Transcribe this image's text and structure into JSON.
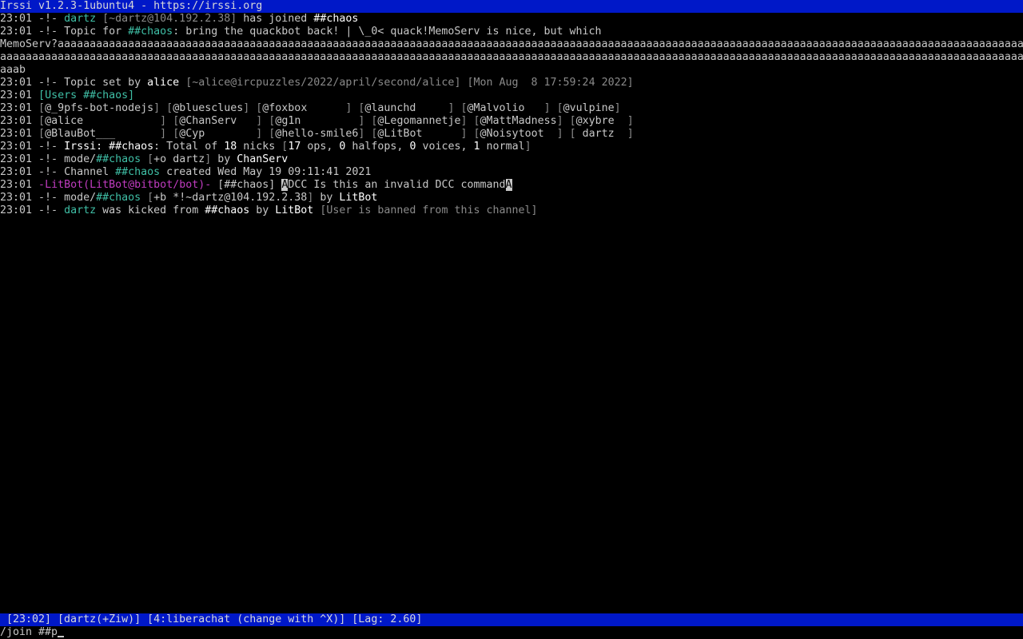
{
  "title_bar": "Irssi v1.2.3-1ubuntu4 - https://irssi.org",
  "colors": {
    "default": "#c8c8c8",
    "bright": "#ffffff",
    "cyan": "#3fbfa6",
    "grey": "#8a8a8a",
    "magenta": "#c03cc0",
    "bar_bg": "#0018c8",
    "bar_fg": "#d8d8d8"
  },
  "lines": [
    [
      [
        "23:01 ",
        "default"
      ],
      [
        "-!- ",
        "default"
      ],
      [
        "dartz",
        "cyan"
      ],
      [
        " [",
        "grey"
      ],
      [
        "~dartz@104.192.2.38",
        "grey"
      ],
      [
        "]",
        "grey"
      ],
      [
        " has joined ",
        "default"
      ],
      [
        "##chaos",
        "bright"
      ]
    ],
    [
      [
        "23:01 ",
        "default"
      ],
      [
        "-!- ",
        "default"
      ],
      [
        "Topic for ",
        "default"
      ],
      [
        "##chaos",
        "cyan"
      ],
      [
        ": bring the quackbot back! | \\_0< quack!MemoServ is nice, but which",
        "default"
      ]
    ],
    [
      [
        "MemoServ?aaaaaaaaaaaaaaaaaaaaaaaaaaaaaaaaaaaaaaaaaaaaaaaaaaaaaaaaaaaaaaaaaaaaaaaaaaaaaaaaaaaaaaaaaaaaaaaaaaaaaaaaaaaaaaaaaaaaaaaaaaaaaaaaaaaaaaaaaaaaaaaaaaaaaaaaaaaaaaaaaaaaaaaaaaaaaaaaaaaaaaa",
        "default"
      ]
    ],
    [
      [
        "aaaaaaaaaaaaaaaaaaaaaaaaaaaaaaaaaaaaaaaaaaaaaaaaaaaaaaaaaaaaaaaaaaaaaaaaaaaaaaaaaaaaaaaaaaaaaaaaaaaaaaaaaaaaaaaaaaaaaaaaaaaaaaaaaaaaaaaaaaaaaaaaaaaaaaaaaaaaaaaaaaaaaaaaaaaaaaaaaaaaaaaaaaaaaaaa",
        "default"
      ]
    ],
    [
      [
        "aaab",
        "default"
      ]
    ],
    [
      [
        "23:01 ",
        "default"
      ],
      [
        "-!- ",
        "default"
      ],
      [
        "Topic set by ",
        "default"
      ],
      [
        "alice",
        "bright"
      ],
      [
        " [",
        "grey"
      ],
      [
        "~alice@ircpuzzles/2022/april/second/alice",
        "grey"
      ],
      [
        "]",
        "grey"
      ],
      [
        " [",
        "grey"
      ],
      [
        "Mon Aug  8 17:59:24 2022",
        "grey"
      ],
      [
        "]",
        "grey"
      ]
    ],
    [
      [
        "23:01 ",
        "default"
      ],
      [
        "[",
        "cyan"
      ],
      [
        "Users ",
        "cyan"
      ],
      [
        "##chaos",
        "cyan"
      ],
      [
        "]",
        "cyan"
      ]
    ],
    [
      [
        "23:01 ",
        "default"
      ],
      [
        "[",
        "grey"
      ],
      [
        "@_9pfs-bot-nodejs",
        "default"
      ],
      [
        "] ",
        "grey"
      ],
      [
        "[",
        "grey"
      ],
      [
        "@bluesclues",
        "default"
      ],
      [
        "] ",
        "grey"
      ],
      [
        "[",
        "grey"
      ],
      [
        "@foxbox      ",
        "default"
      ],
      [
        "] ",
        "grey"
      ],
      [
        "[",
        "grey"
      ],
      [
        "@launchd     ",
        "default"
      ],
      [
        "] ",
        "grey"
      ],
      [
        "[",
        "grey"
      ],
      [
        "@Malvolio   ",
        "default"
      ],
      [
        "] ",
        "grey"
      ],
      [
        "[",
        "grey"
      ],
      [
        "@vulpine",
        "default"
      ],
      [
        "]",
        "grey"
      ]
    ],
    [
      [
        "23:01 ",
        "default"
      ],
      [
        "[",
        "grey"
      ],
      [
        "@alice            ",
        "default"
      ],
      [
        "] ",
        "grey"
      ],
      [
        "[",
        "grey"
      ],
      [
        "@ChanServ   ",
        "default"
      ],
      [
        "] ",
        "grey"
      ],
      [
        "[",
        "grey"
      ],
      [
        "@g1n         ",
        "default"
      ],
      [
        "] ",
        "grey"
      ],
      [
        "[",
        "grey"
      ],
      [
        "@Legomannetje",
        "default"
      ],
      [
        "] ",
        "grey"
      ],
      [
        "[",
        "grey"
      ],
      [
        "@MattMadness",
        "default"
      ],
      [
        "] ",
        "grey"
      ],
      [
        "[",
        "grey"
      ],
      [
        "@xybre  ",
        "default"
      ],
      [
        "]",
        "grey"
      ]
    ],
    [
      [
        "23:01 ",
        "default"
      ],
      [
        "[",
        "grey"
      ],
      [
        "@BlauBot___       ",
        "default"
      ],
      [
        "] ",
        "grey"
      ],
      [
        "[",
        "grey"
      ],
      [
        "@Cyp        ",
        "default"
      ],
      [
        "] ",
        "grey"
      ],
      [
        "[",
        "grey"
      ],
      [
        "@hello-smile6",
        "default"
      ],
      [
        "] ",
        "grey"
      ],
      [
        "[",
        "grey"
      ],
      [
        "@LitBot      ",
        "default"
      ],
      [
        "] ",
        "grey"
      ],
      [
        "[",
        "grey"
      ],
      [
        "@Noisytoot  ",
        "default"
      ],
      [
        "] ",
        "grey"
      ],
      [
        "[",
        "grey"
      ],
      [
        " dartz  ",
        "default"
      ],
      [
        "]",
        "grey"
      ]
    ],
    [
      [
        "23:01 ",
        "default"
      ],
      [
        "-!- ",
        "default"
      ],
      [
        "Irssi: ",
        "bright"
      ],
      [
        "##chaos",
        "bright"
      ],
      [
        ": Total of ",
        "default"
      ],
      [
        "18",
        "bright"
      ],
      [
        " nicks ",
        "default"
      ],
      [
        "[",
        "grey"
      ],
      [
        "17",
        "bright"
      ],
      [
        " ops, ",
        "default"
      ],
      [
        "0",
        "bright"
      ],
      [
        " halfops, ",
        "default"
      ],
      [
        "0",
        "bright"
      ],
      [
        " voices, ",
        "default"
      ],
      [
        "1",
        "bright"
      ],
      [
        " normal",
        "default"
      ],
      [
        "]",
        "grey"
      ]
    ],
    [
      [
        "23:01 ",
        "default"
      ],
      [
        "-!- ",
        "default"
      ],
      [
        "mode/",
        "default"
      ],
      [
        "##chaos",
        "cyan"
      ],
      [
        " [",
        "grey"
      ],
      [
        "+o dartz",
        "default"
      ],
      [
        "]",
        "grey"
      ],
      [
        " by ",
        "default"
      ],
      [
        "ChanServ",
        "bright"
      ]
    ],
    [
      [
        "23:01 ",
        "default"
      ],
      [
        "-!- ",
        "default"
      ],
      [
        "Channel ",
        "default"
      ],
      [
        "##chaos",
        "cyan"
      ],
      [
        " created Wed May 19 09:11:41 2021",
        "default"
      ]
    ],
    [
      [
        "23:01 ",
        "default"
      ],
      [
        "-",
        "magenta"
      ],
      [
        "LitBot",
        "magenta"
      ],
      [
        "(",
        "magenta"
      ],
      [
        "LitBot@bitbot/bot",
        "magenta"
      ],
      [
        ")",
        "magenta"
      ],
      [
        "-",
        "magenta"
      ],
      [
        " [##chaos] ",
        "default"
      ],
      [
        "A",
        "rev"
      ],
      [
        "DCC Is this an invalid DCC command",
        "default"
      ],
      [
        "A",
        "rev"
      ]
    ],
    [
      [
        "23:01 ",
        "default"
      ],
      [
        "-!- ",
        "default"
      ],
      [
        "mode/",
        "default"
      ],
      [
        "##chaos",
        "cyan"
      ],
      [
        " [",
        "grey"
      ],
      [
        "+b *!~dartz@104.192.2.38",
        "default"
      ],
      [
        "]",
        "grey"
      ],
      [
        " by ",
        "default"
      ],
      [
        "LitBot",
        "bright"
      ]
    ],
    [
      [
        "23:01 ",
        "default"
      ],
      [
        "-!- ",
        "default"
      ],
      [
        "dartz",
        "cyan"
      ],
      [
        " was kicked from ",
        "default"
      ],
      [
        "##chaos",
        "bright"
      ],
      [
        " by ",
        "default"
      ],
      [
        "LitBot",
        "bright"
      ],
      [
        " [",
        "grey"
      ],
      [
        "User is banned from this channel",
        "grey"
      ],
      [
        "]",
        "grey"
      ]
    ]
  ],
  "status_bar": " [23:02] [dartz(+Ziw)] [4:liberachat (change with ^X)] [Lag: 2.60]",
  "input": {
    "prompt": "",
    "value": "/join ##p"
  }
}
